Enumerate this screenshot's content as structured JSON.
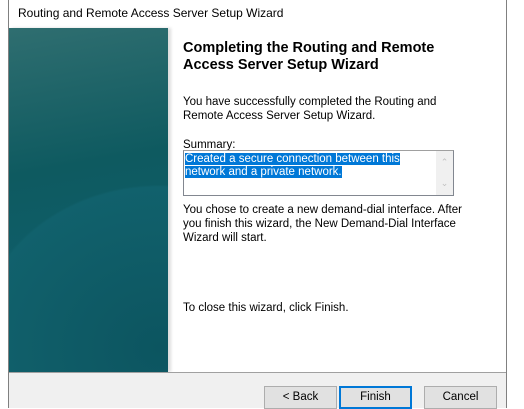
{
  "window": {
    "title": "Routing and Remote Access Server Setup Wizard"
  },
  "main": {
    "heading": "Completing the Routing and Remote Access Server Setup Wizard",
    "intro": "You have successfully completed the Routing and Remote Access Server Setup Wizard.",
    "summary_label": "Summary:",
    "summary_text": "Created a secure connection between this network and a private network.",
    "info": "You chose to create a new demand-dial interface. After you finish this wizard, the New Demand-Dial Interface Wizard will start.",
    "close_hint": "To close this wizard, click Finish."
  },
  "buttons": {
    "back": "< Back",
    "finish": "Finish",
    "cancel": "Cancel"
  },
  "icons": {
    "scroll_up": "chevron-up-icon",
    "scroll_down": "chevron-down-icon"
  },
  "colors": {
    "selection": "#0078d7",
    "sidebar": "#0e5a60"
  }
}
